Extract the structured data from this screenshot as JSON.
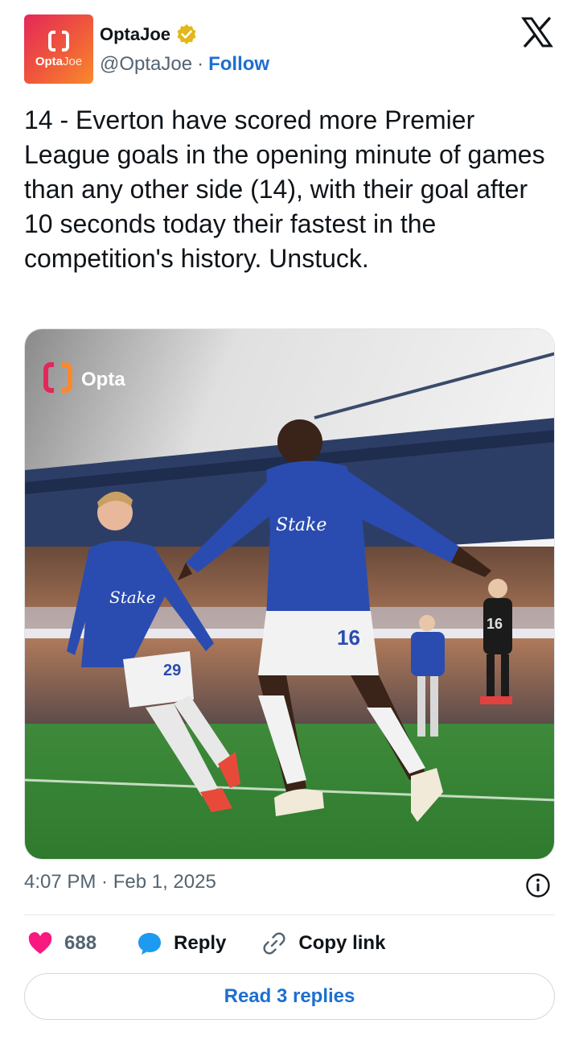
{
  "header": {
    "avatar_text_bold": "Opta",
    "avatar_text_light": "Joe",
    "display_name": "OptaJoe",
    "handle": "@OptaJoe",
    "separator": "·",
    "follow_label": "Follow"
  },
  "tweet": {
    "text": "14 - Everton have scored more Premier League goals in the opening minute of games than any other side (14), with their goal after 10 seconds today their fastest in the competition's history. Unstuck.",
    "media_watermark": "Opta",
    "shirt_sponsor": "Stake",
    "shirt_numbers": [
      "16",
      "29",
      "16"
    ],
    "timestamp": "4:07 PM · Feb 1, 2025"
  },
  "actions": {
    "like_count": "688",
    "reply_label": "Reply",
    "copy_link_label": "Copy link"
  },
  "footer": {
    "read_replies_label": "Read 3 replies"
  },
  "colors": {
    "follow_blue": "#1d6fd1",
    "like_pink": "#f91880",
    "reply_blue": "#1d9bf0",
    "everton_blue": "#2a4cb0",
    "verified_gold": "#e2b719"
  },
  "icons": [
    "opta-logo-icon",
    "verified-icon",
    "x-logo-icon",
    "info-icon",
    "heart-icon",
    "reply-bubble-icon",
    "link-icon"
  ]
}
